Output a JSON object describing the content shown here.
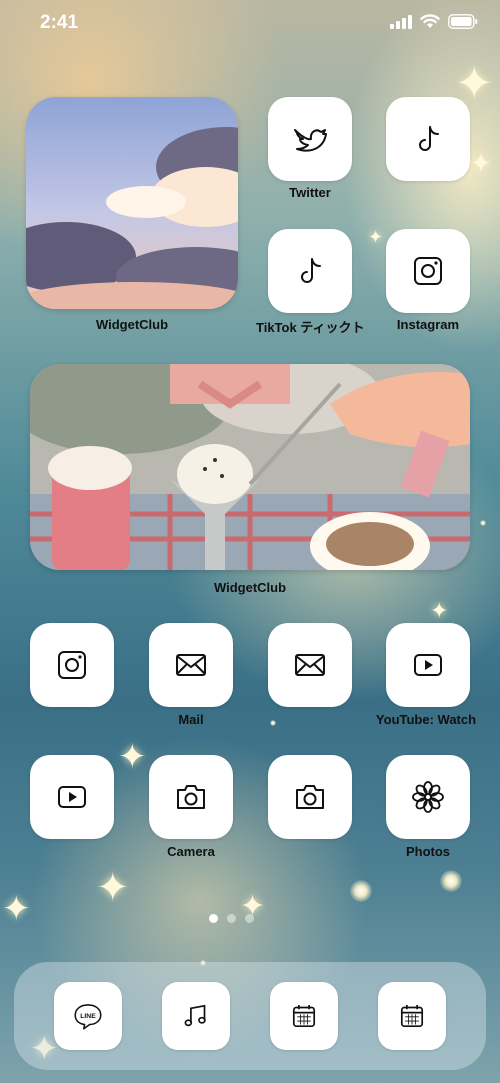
{
  "status_bar": {
    "time": "2:41"
  },
  "widgets": [
    {
      "label": "WidgetClub",
      "image": "sky-clouds-photo"
    },
    {
      "label": "WidgetClub",
      "image": "winter-dessert-photo"
    }
  ],
  "apps": {
    "twitter": {
      "label": "Twitter",
      "icon": "twitter-bird-icon"
    },
    "tiktok_top": {
      "label": "",
      "icon": "tiktok-note-icon"
    },
    "tiktok": {
      "label": "TikTok ティックト",
      "icon": "tiktok-note-icon"
    },
    "instagram": {
      "label": "Instagram",
      "icon": "instagram-camera-icon"
    },
    "row3_instagram": {
      "label": "",
      "icon": "instagram-camera-icon"
    },
    "mail": {
      "label": "Mail",
      "icon": "mail-envelope-icon"
    },
    "row3_mail": {
      "label": "",
      "icon": "mail-envelope-icon"
    },
    "youtube": {
      "label": "YouTube: Watch",
      "icon": "play-button-icon"
    },
    "row4_youtube": {
      "label": "",
      "icon": "play-button-icon"
    },
    "camera": {
      "label": "Camera",
      "icon": "camera-icon"
    },
    "row4_camera": {
      "label": "",
      "icon": "camera-icon"
    },
    "photos": {
      "label": "Photos",
      "icon": "flower-icon"
    }
  },
  "page_dots": {
    "count": 3,
    "active": 0
  },
  "dock": [
    {
      "name": "line",
      "text": "LINE",
      "icon": "line-bubble-icon"
    },
    {
      "name": "music",
      "icon": "music-note-icon"
    },
    {
      "name": "calendar-1",
      "icon": "calendar-icon"
    },
    {
      "name": "calendar-2",
      "icon": "calendar-icon"
    }
  ]
}
